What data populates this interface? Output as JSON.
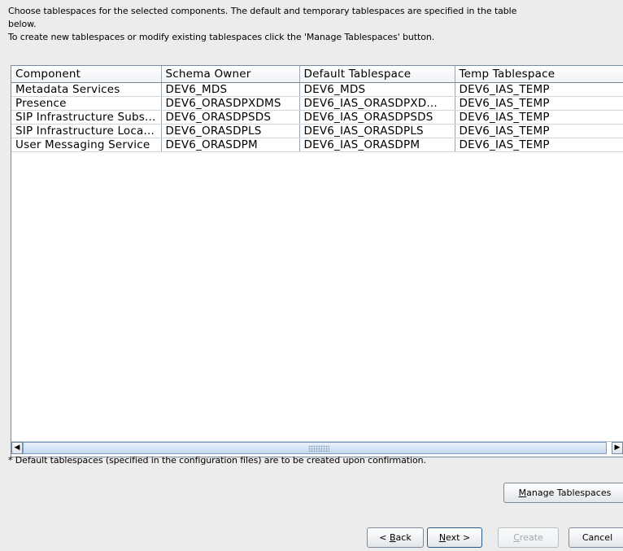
{
  "instructions": {
    "line1": "Choose tablespaces for the selected components. The default and temporary tablespaces are specified in the table",
    "line2": "below.",
    "line3": "To create new tablespaces or modify existing tablespaces click the 'Manage Tablespaces' button."
  },
  "table": {
    "columns": [
      "Component",
      "Schema Owner",
      "Default Tablespace",
      "Temp Tablespace"
    ],
    "rows": [
      [
        "Metadata Services",
        "DEV6_MDS",
        "DEV6_MDS",
        "DEV6_IAS_TEMP"
      ],
      [
        "Presence",
        "DEV6_ORASDPXDMS",
        "DEV6_IAS_ORASDPXD...",
        "DEV6_IAS_TEMP"
      ],
      [
        "SIP Infrastructure Subs...",
        "DEV6_ORASDPSDS",
        "DEV6_IAS_ORASDPSDS",
        "DEV6_IAS_TEMP"
      ],
      [
        "SIP Infrastructure Loca...",
        "DEV6_ORASDPLS",
        "DEV6_IAS_ORASDPLS",
        "DEV6_IAS_TEMP"
      ],
      [
        "User Messaging Service",
        "DEV6_ORASDPM",
        "DEV6_IAS_ORASDPM",
        "DEV6_IAS_TEMP"
      ]
    ]
  },
  "scrollbar": {
    "left_arrow": "◀",
    "right_arrow": "▶"
  },
  "note": "* Default tablespaces (specified in the configuration files) are to be created upon confirmation.",
  "buttons": {
    "manage": {
      "mnemonic": "M",
      "rest": "anage Tablespaces"
    },
    "back": {
      "pre": "< ",
      "mnemonic": "B",
      "rest": "ack"
    },
    "next": {
      "mnemonic": "N",
      "rest": "ext >"
    },
    "create": {
      "mnemonic": "C",
      "rest": "reate",
      "enabled": false
    },
    "cancel": {
      "label": "Cancel"
    }
  }
}
